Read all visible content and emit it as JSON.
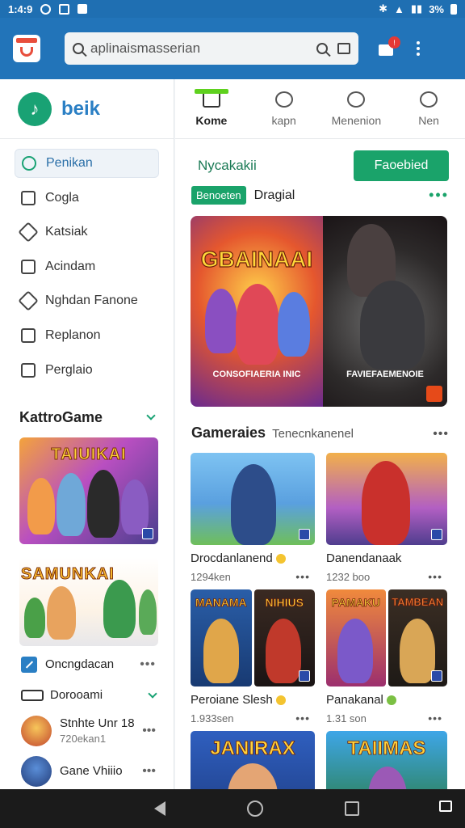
{
  "status_bar": {
    "time": "1:4:9",
    "battery": "3%"
  },
  "search": {
    "placeholder": "aplinaismasserian",
    "notification_count": "!"
  },
  "brand": {
    "name": "beik",
    "logo_glyph": "♪"
  },
  "sidebar": {
    "items": [
      {
        "label": "Penikan",
        "icon": "search-icon",
        "active": true
      },
      {
        "label": "Cogla",
        "icon": "square-icon"
      },
      {
        "label": "Katsiak",
        "icon": "tag-icon"
      },
      {
        "label": "Acindam",
        "icon": "camera-icon"
      },
      {
        "label": "Nghdan Fanone",
        "icon": "heart-icon"
      },
      {
        "label": "Replanon",
        "icon": "folder-icon"
      },
      {
        "label": "Perglaio",
        "icon": "edit-icon"
      }
    ],
    "section_title": "KattroGame",
    "card1_title": "TAIUIKAI",
    "card2_title": "SAMUNKAI",
    "row1_label": "Oncngdacan",
    "row2_label": "Dorooami",
    "friends": [
      {
        "name": "Stnhte Unr 18",
        "sub": "720ekan1"
      },
      {
        "name": "Gane Vhiiio",
        "sub": ""
      }
    ]
  },
  "tabs": [
    {
      "label": "Kome",
      "active": true
    },
    {
      "label": "kapn"
    },
    {
      "label": "Menenion"
    },
    {
      "label": "Nen"
    }
  ],
  "featured": {
    "heading": "Nycakakii",
    "button": "Faoebied",
    "tag": "Benoeten",
    "tag_label": "Dragial",
    "banner_title": "GBAINAAI",
    "banner_caption_left": "CONSOFIAERIA INIC",
    "banner_caption_right": "FAVIEFAEMENOIE"
  },
  "games_section": {
    "title": "Gameraies",
    "subtitle": "Tenecnkanenel"
  },
  "games": [
    {
      "name": "Drocdanlanend",
      "size": "1294ken"
    },
    {
      "name": "Danendanaak",
      "size": "1232 boo"
    },
    {
      "name": "Peroiane Slesh",
      "size": "1.933sen",
      "left_title": "MANAMA",
      "right_title": "NIHIUS"
    },
    {
      "name": "Panakanal",
      "size": "1.31 son",
      "left_title": "PAMAKU",
      "right_title": "TAMBEAN"
    },
    {
      "name": "JANIRAX",
      "size": ""
    },
    {
      "name": "TAIIMAS",
      "size": ""
    }
  ],
  "colors": {
    "primary": "#2274b9",
    "accent": "#1aa36a",
    "tab_indicator": "#5fd11e"
  }
}
